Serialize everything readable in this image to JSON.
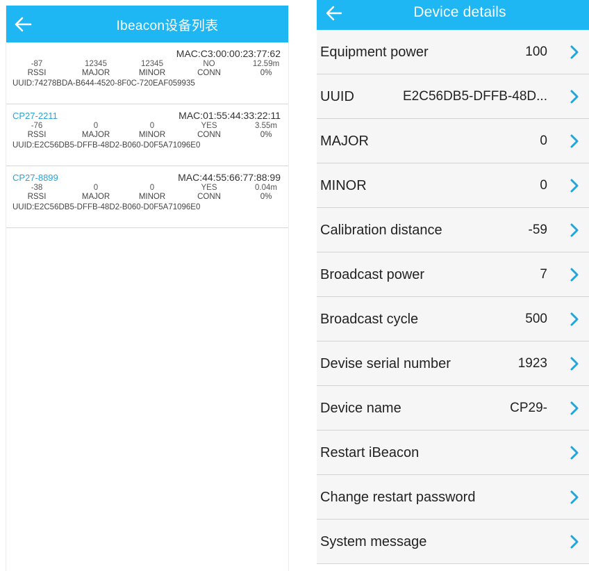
{
  "left_screen": {
    "title": "Ibeacon设备列表",
    "devices": [
      {
        "name": "",
        "mac": "MAC:C3:00:00:23:77:62",
        "rssi": "-87",
        "major": "12345",
        "minor": "12345",
        "conn": "NO",
        "distance": "12.59m",
        "rssi_label": "RSSI",
        "major_label": "MAJOR",
        "minor_label": "MINOR",
        "conn_label": "CONN",
        "percent": "0%",
        "uuid": "UUID:74278BDA-B644-4520-8F0C-720EAF059935"
      },
      {
        "name": "CP27-2211",
        "mac": "MAC:01:55:44:33:22:11",
        "rssi": "-76",
        "major": "0",
        "minor": "0",
        "conn": "YES",
        "distance": "3.55m",
        "rssi_label": "RSSI",
        "major_label": "MAJOR",
        "minor_label": "MINOR",
        "conn_label": "CONN",
        "percent": "0%",
        "uuid": "UUID:E2C56DB5-DFFB-48D2-B060-D0F5A71096E0"
      },
      {
        "name": "CP27-8899",
        "mac": "MAC:44:55:66:77:88:99",
        "rssi": "-38",
        "major": "0",
        "minor": "0",
        "conn": "YES",
        "distance": "0.04m",
        "rssi_label": "RSSI",
        "major_label": "MAJOR",
        "minor_label": "MINOR",
        "conn_label": "CONN",
        "percent": "0%",
        "uuid": "UUID:E2C56DB5-DFFB-48D2-B060-D0F5A71096E0"
      }
    ]
  },
  "right_screen": {
    "title": "Device details",
    "rows": [
      {
        "label": "Equipment power",
        "value": "100"
      },
      {
        "label": "UUID",
        "value": "E2C56DB5-DFFB-48D..."
      },
      {
        "label": "MAJOR",
        "value": "0"
      },
      {
        "label": "MINOR",
        "value": "0"
      },
      {
        "label": "Calibration distance",
        "value": "-59"
      },
      {
        "label": "Broadcast power",
        "value": "7"
      },
      {
        "label": "Broadcast cycle",
        "value": "500"
      },
      {
        "label": "Devise serial number",
        "value": "1923"
      },
      {
        "label": "Device name",
        "value": "CP29-"
      },
      {
        "label": "Restart iBeacon",
        "value": ""
      },
      {
        "label": "Change restart password",
        "value": ""
      },
      {
        "label": "System message",
        "value": ""
      }
    ]
  },
  "colors": {
    "appbar": "#1fb7f3",
    "device_name": "#29a3d9",
    "chevron": "#1fa6e0",
    "row_bg": "#f6f6f6"
  },
  "icons": {
    "back": "arrow-left-icon",
    "chevron": "chevron-right-icon"
  }
}
